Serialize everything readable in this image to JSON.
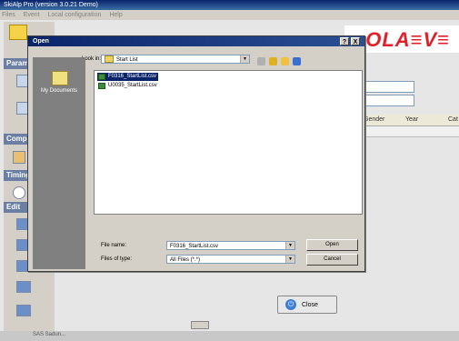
{
  "app": {
    "title": "SkiAlp Pro (version 3.0.21 Demo)",
    "menu": [
      "Files",
      "Event",
      "Local configuration",
      "Help"
    ],
    "sections": [
      "Parame",
      "Compe",
      "Timing",
      "Edit"
    ],
    "logo_text": "OLA≡V≡",
    "grid_columns": [
      "Gender",
      "Year",
      "Cat"
    ],
    "close_label": "Close",
    "bottom_label": "SAS Sadun..."
  },
  "dialog": {
    "title": "Open",
    "look_in_label": "Look in:",
    "look_in_value": "Start List",
    "places_label": "My Documents",
    "files": [
      {
        "name": "F0316_StartList.csv",
        "selected": true
      },
      {
        "name": "U0035_StartList.csv",
        "selected": false
      }
    ],
    "file_name_label": "File name:",
    "file_name_value": "F0316_StartList.csv",
    "file_type_label": "Files of type:",
    "file_type_value": "All Files (*.*)",
    "open_label": "Open",
    "cancel_label": "Cancel",
    "help_label": "?",
    "close_label": "X"
  }
}
